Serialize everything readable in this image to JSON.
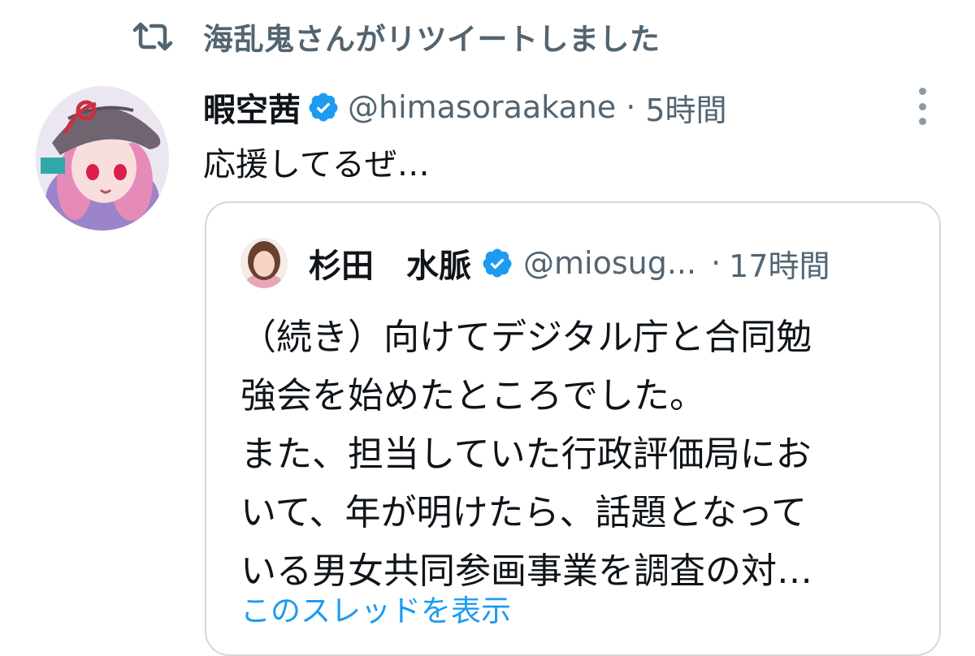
{
  "retweet": {
    "icon": "retweet-icon",
    "text": "海乱鬼さんがリツイートしました"
  },
  "tweet": {
    "display_name": "暇空茜",
    "verified_icon": "verified-badge-icon",
    "handle": "@himasoraakane",
    "separator": "·",
    "time": "5時間",
    "more_icon": "more-options-icon",
    "text": "応援してるぜ…"
  },
  "quote": {
    "display_name": "杉田　水脈",
    "verified_icon": "verified-badge-icon",
    "handle": "@miosug...",
    "separator": "·",
    "time": "17時間",
    "lines": [
      "（続き）向けてデジタル庁と合同勉",
      "強会を始めたところでした。",
      "また、担当していた行政評価局にお",
      "いて、年が明けたら、話題となって",
      "いる男女共同参画事業を調査の対…"
    ],
    "show_thread": "このスレッドを表示"
  },
  "colors": {
    "accent": "#1d9bf0",
    "secondary_text": "#536471",
    "primary_text": "#0f1419",
    "border": "#cfd9de"
  }
}
